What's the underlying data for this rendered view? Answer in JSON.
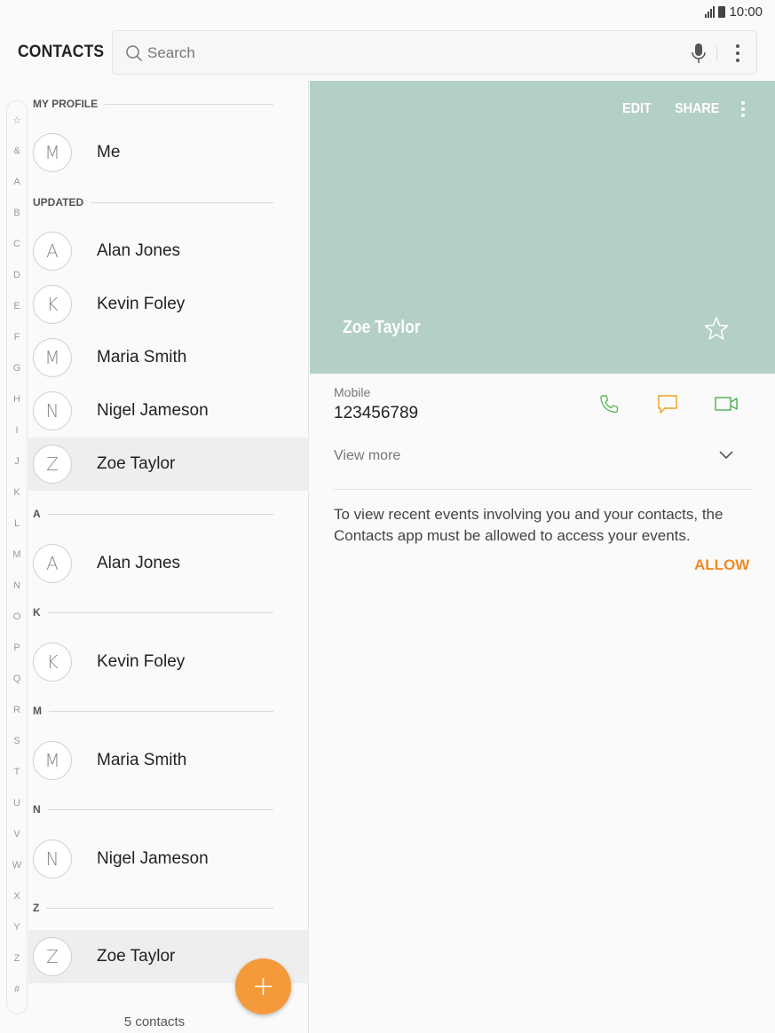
{
  "status_bar": {
    "time": "10:00"
  },
  "topbar": {
    "app_title": "CONTACTS",
    "search_placeholder": "Search"
  },
  "index_letters": [
    "☆",
    "&",
    "A",
    "B",
    "C",
    "D",
    "E",
    "F",
    "G",
    "H",
    "I",
    "J",
    "K",
    "L",
    "M",
    "N",
    "O",
    "P",
    "Q",
    "R",
    "S",
    "T",
    "U",
    "V",
    "W",
    "X",
    "Y",
    "Z",
    "#"
  ],
  "sections": {
    "my_profile": "MY PROFILE",
    "updated": "UPDATED",
    "a": "A",
    "k": "K",
    "m": "M",
    "n": "N",
    "z": "Z"
  },
  "contacts": {
    "me": {
      "initial": "M",
      "name": "Me"
    },
    "updated": [
      {
        "initial": "A",
        "name": "Alan Jones"
      },
      {
        "initial": "K",
        "name": "Kevin Foley"
      },
      {
        "initial": "M",
        "name": "Maria Smith"
      },
      {
        "initial": "N",
        "name": "Nigel Jameson"
      },
      {
        "initial": "Z",
        "name": "Zoe Taylor"
      }
    ],
    "alpha": [
      {
        "initial": "A",
        "name": "Alan Jones"
      },
      {
        "initial": "K",
        "name": "Kevin Foley"
      },
      {
        "initial": "M",
        "name": "Maria Smith"
      },
      {
        "initial": "N",
        "name": "Nigel Jameson"
      },
      {
        "initial": "Z",
        "name": "Zoe Taylor"
      }
    ]
  },
  "contact_count": "5 contacts",
  "detail": {
    "edit_label": "EDIT",
    "share_label": "SHARE",
    "name": "Zoe Taylor",
    "phone_type": "Mobile",
    "phone_number": "123456789",
    "view_more": "View more",
    "events_text": "To view recent events involving you and your contacts, the Contacts app must be allowed to access your events.",
    "allow_label": "ALLOW"
  },
  "colors": {
    "hero_bg": "#b4cfc6",
    "accent_orange": "#f59a3b",
    "call_green": "#5cb85c",
    "msg_orange": "#f0a020",
    "video_green": "#4caf50"
  }
}
